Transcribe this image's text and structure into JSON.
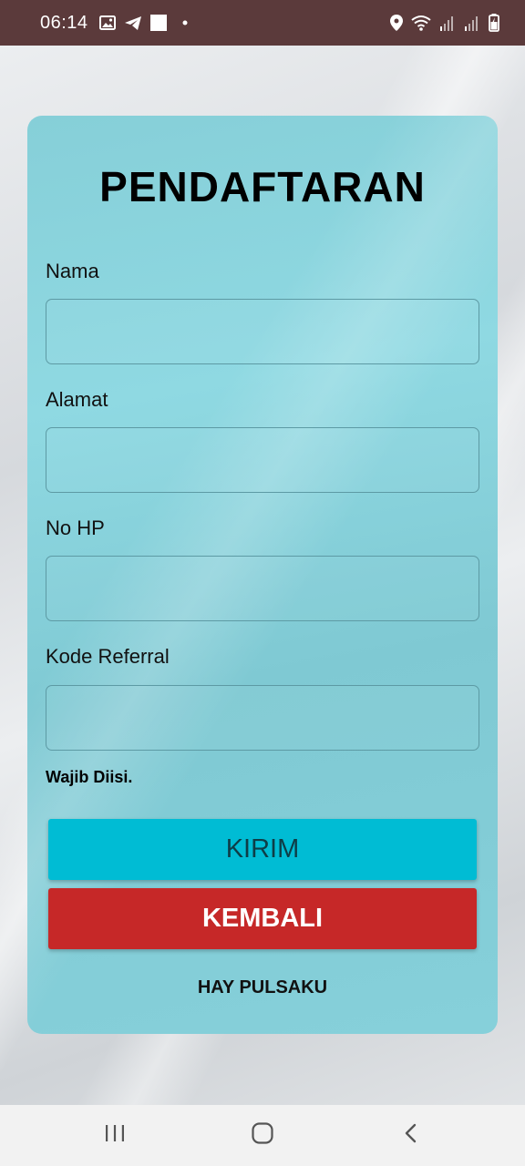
{
  "status_bar": {
    "time": "06:14",
    "left_icons": [
      "gallery-icon",
      "telegram-icon",
      "square-notification-icon",
      "dot-icon"
    ],
    "right_icons": [
      "location-icon",
      "wifi-icon",
      "signal-icon",
      "signal-icon",
      "battery-charging-icon"
    ]
  },
  "form": {
    "title": "PENDAFTARAN",
    "fields": [
      {
        "label": "Nama",
        "value": ""
      },
      {
        "label": "Alamat",
        "value": ""
      },
      {
        "label": "No HP",
        "value": ""
      },
      {
        "label": "Kode Referral",
        "value": ""
      }
    ],
    "required_note": "Wajib Diisi.",
    "submit_label": "KIRIM",
    "back_label": "KEMBALI",
    "brand": "HAY PULSAKU"
  },
  "colors": {
    "status_bar": "#5b3a3b",
    "card": "#8fd9e2",
    "submit_button": "#00bcd4",
    "back_button": "#c62828"
  },
  "nav_bar": {
    "icons": [
      "recent-apps-icon",
      "home-icon",
      "back-icon"
    ]
  }
}
